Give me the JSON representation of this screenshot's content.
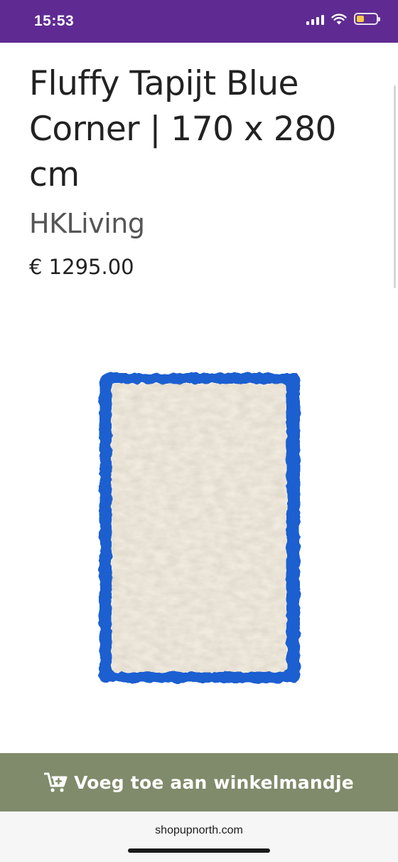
{
  "status_bar": {
    "time": "15:53",
    "icons": [
      "signal-icon",
      "wifi-icon",
      "battery-icon"
    ],
    "background_color": "#5f2b92",
    "battery_level": 0.4
  },
  "product": {
    "title": "Fluffy Tapijt Blue Corner | 170 x 280 cm",
    "brand": "HKLiving",
    "price": "€ 1295.00",
    "image_colors": {
      "border": "#1c5fd0",
      "center": "#f1ebdf"
    }
  },
  "cart_button": {
    "label": "Voeg toe aan winkelmandje",
    "icon": "cart-plus-icon",
    "background_color": "#7f8b6a"
  },
  "browser": {
    "url": "shopupnorth.com"
  }
}
